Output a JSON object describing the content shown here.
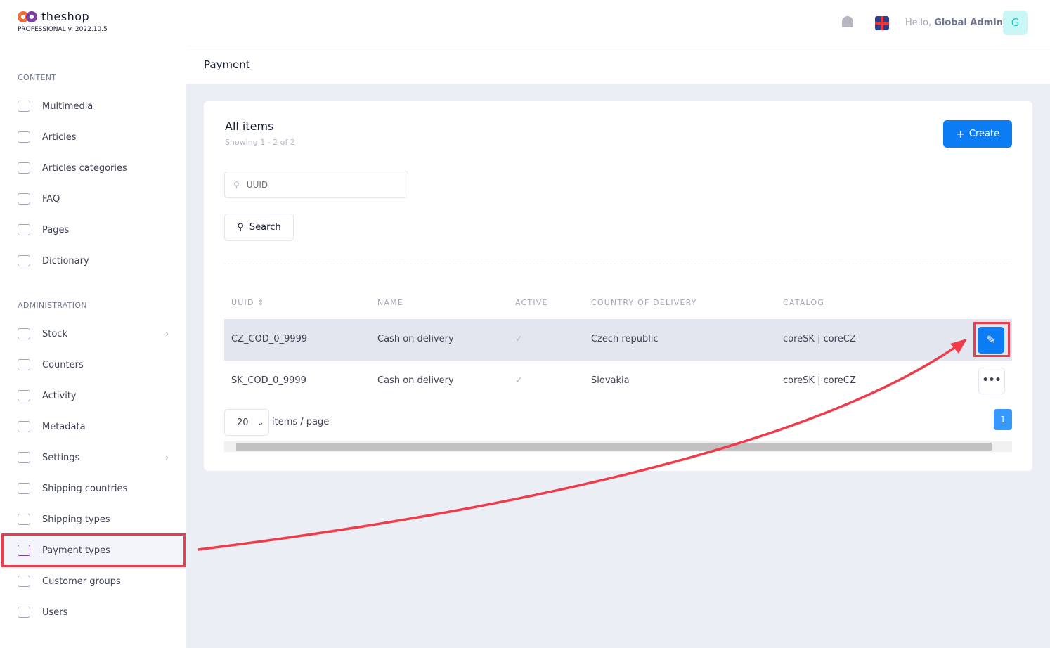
{
  "brand": {
    "name": "theshop",
    "edition": "PROFESSIONAL",
    "version": "v. 2022.10.5"
  },
  "sidebar": {
    "sections": [
      {
        "title": "CONTENT",
        "items": [
          {
            "label": "Multimedia"
          },
          {
            "label": "Articles"
          },
          {
            "label": "Articles categories"
          },
          {
            "label": "FAQ"
          },
          {
            "label": "Pages"
          },
          {
            "label": "Dictionary"
          }
        ]
      },
      {
        "title": "ADMINISTRATION",
        "items": [
          {
            "label": "Stock",
            "chevron": true
          },
          {
            "label": "Counters"
          },
          {
            "label": "Activity"
          },
          {
            "label": "Metadata"
          },
          {
            "label": "Settings",
            "chevron": true
          },
          {
            "label": "Shipping countries"
          },
          {
            "label": "Shipping types"
          },
          {
            "label": "Payment types",
            "active": true
          },
          {
            "label": "Customer groups"
          },
          {
            "label": "Users"
          }
        ]
      }
    ]
  },
  "header": {
    "hello": "Hello,",
    "user": "Global Admin",
    "avatar": "G"
  },
  "page": {
    "title": "Payment"
  },
  "card": {
    "title": "All items",
    "showing": "Showing 1 - 2 of 2",
    "create": "Create",
    "uuid_placeholder": "UUID",
    "search": "Search"
  },
  "table": {
    "columns": [
      "UUID",
      "NAME",
      "ACTIVE",
      "COUNTRY OF DELIVERY",
      "CATALOG"
    ],
    "rows": [
      {
        "uuid": "CZ_COD_0_9999",
        "name": "Cash on delivery",
        "active": "✓",
        "country": "Czech republic",
        "catalog": "coreSK | coreCZ"
      },
      {
        "uuid": "SK_COD_0_9999",
        "name": "Cash on delivery",
        "active": "✓",
        "country": "Slovakia",
        "catalog": "coreSK | coreCZ"
      }
    ]
  },
  "pagination": {
    "per_page": "20",
    "per_page_label": "items / page",
    "current": "1"
  },
  "colors": {
    "accent": "#0c7cf5",
    "highlight": "#f03c4a"
  }
}
